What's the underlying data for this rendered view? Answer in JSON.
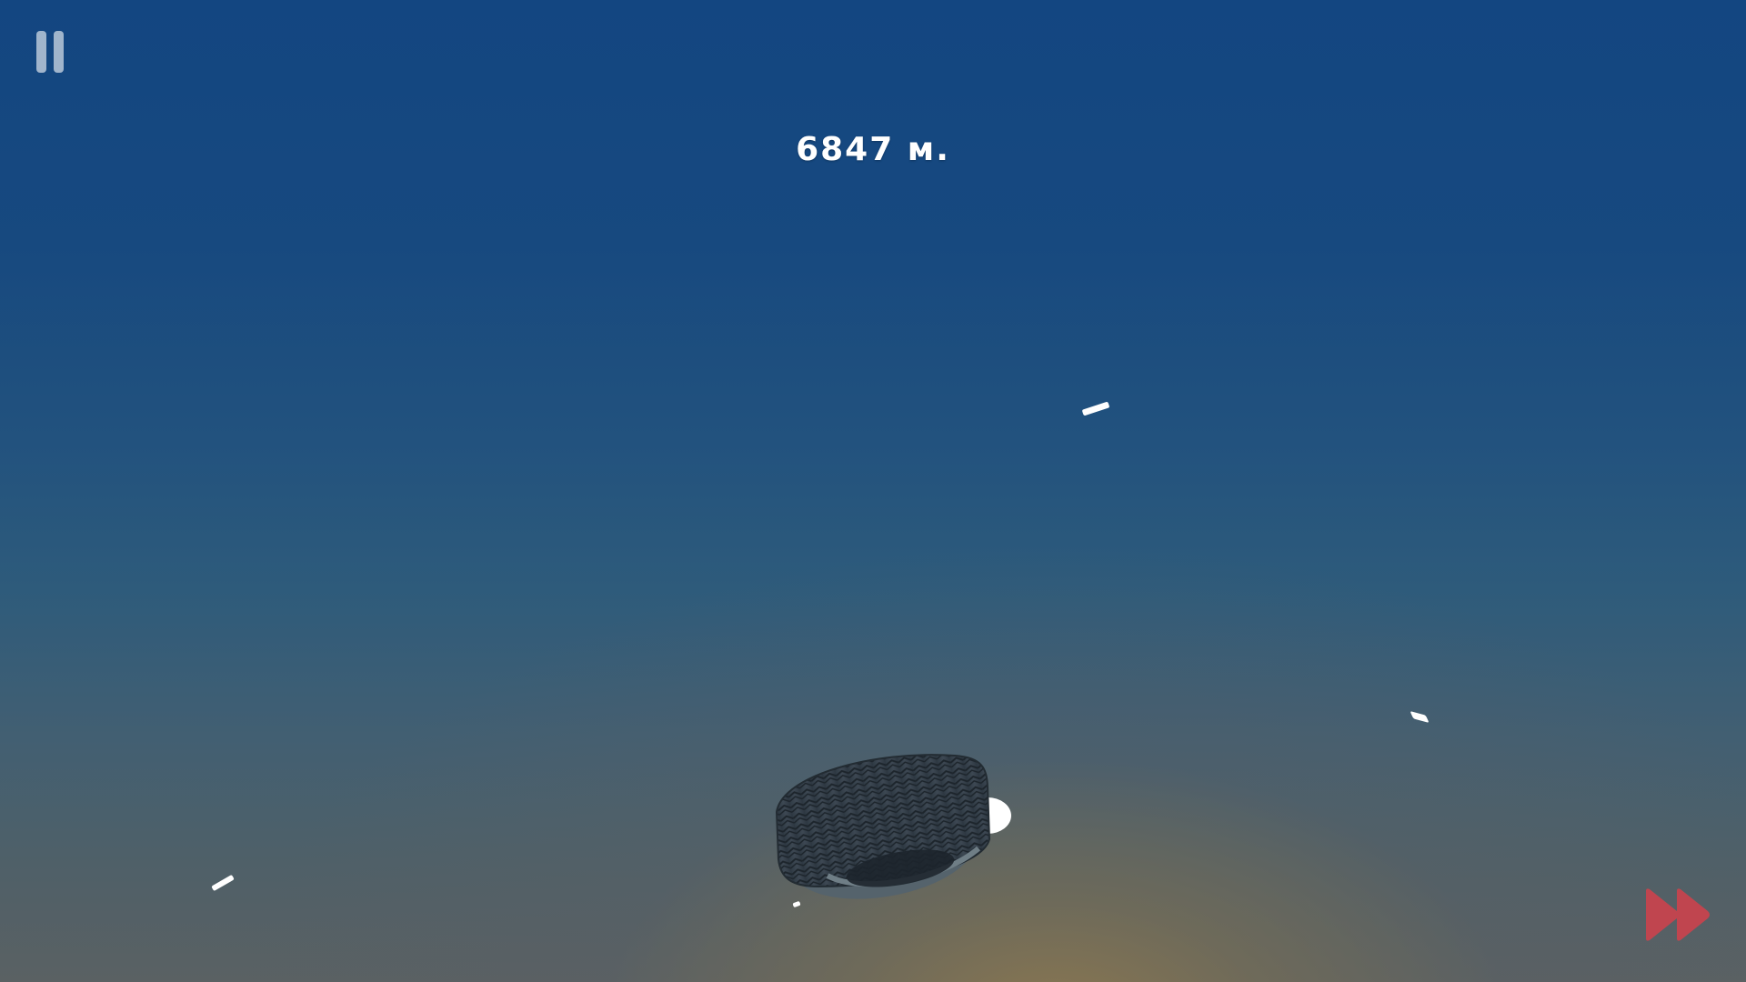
{
  "hud": {
    "distance_text": "6847 м."
  },
  "icons": {
    "pause": "pause-icon",
    "fast_forward": "fast-forward-icon"
  },
  "colors": {
    "sky_top": "#134681",
    "sky_bottom_glow": "#8c7850",
    "fast_forward": "#c0454f",
    "pause_icon": "#ffffff99"
  }
}
